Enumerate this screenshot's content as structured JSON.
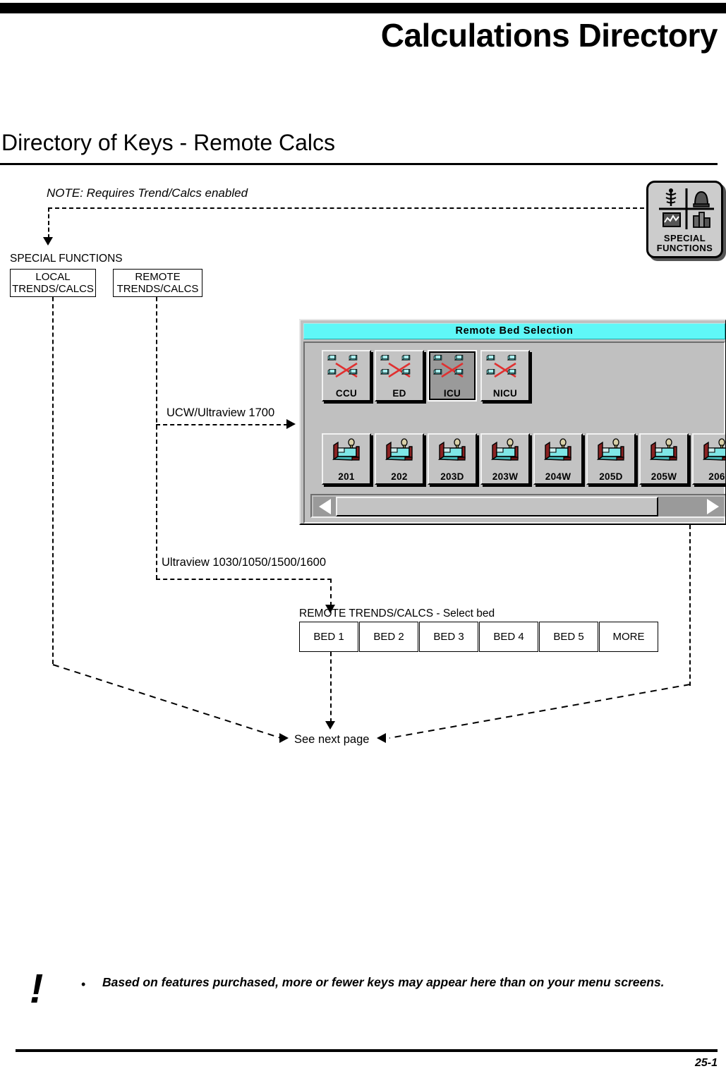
{
  "document": {
    "chapter_title": "Calculations Directory",
    "section_title": "Directory of Keys - Remote Calcs",
    "page_number": "25-1"
  },
  "flow": {
    "note": "NOTE: Requires Trend/Calcs enabled",
    "special_functions_caption": "SPECIAL FUNCTIONS",
    "keys": [
      {
        "line1": "LOCAL",
        "line2": "TRENDS/CALCS"
      },
      {
        "line1": "REMOTE",
        "line2": "TRENDS/CALCS"
      }
    ],
    "branch_ucw_label": "UCW/Ultraview 1700",
    "branch_ultraview_label": "Ultraview 1030/1050/1500/1600",
    "remote_select_caption": "REMOTE TRENDS/CALCS - Select bed",
    "bed_keys": [
      "BED 1",
      "BED 2",
      "BED 3",
      "BED 4",
      "BED 5",
      "MORE"
    ],
    "see_next_page": "See next page"
  },
  "special_functions_key": {
    "label_line1": "SPECIAL",
    "label_line2": "FUNCTIONS",
    "icons": [
      "caduceus-icon",
      "bell-icon",
      "trend-graph-icon",
      "buildings-icon"
    ]
  },
  "remote_bed_selection": {
    "title": "Remote Bed Selection",
    "units": [
      {
        "label": "CCU",
        "selected": false
      },
      {
        "label": "ED",
        "selected": false
      },
      {
        "label": "ICU",
        "selected": true
      },
      {
        "label": "NICU",
        "selected": false
      }
    ],
    "beds": [
      "201",
      "202",
      "203D",
      "203W",
      "204W",
      "205D",
      "205W",
      "206"
    ],
    "scrollbar": {
      "left_arrow": "scroll-left-icon",
      "right_arrow": "scroll-right-icon"
    },
    "colors": {
      "titlebar": "#5ff7f7",
      "face": "#c0c0c0",
      "selected_face": "#9a9a9a",
      "bed_mattress": "#7fe6e6",
      "bed_frame": "#8b2222"
    }
  },
  "footnote": {
    "symbol": "!",
    "bullet": "•",
    "text": "Based on features purchased, more or fewer keys may appear here than on your menu screens."
  }
}
